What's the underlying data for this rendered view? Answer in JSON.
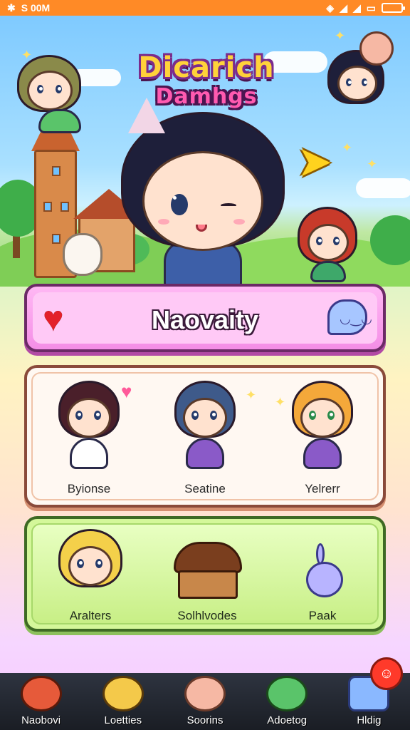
{
  "status_bar": {
    "left_text": "S 00M",
    "left_icon": "flash-icon",
    "right_icons": [
      "wifi-icon",
      "signal-icon",
      "signal-icon",
      "battery-icon"
    ]
  },
  "app": {
    "logo_line1": "Dicarich",
    "logo_line2": "Damhgs"
  },
  "banner": {
    "title": "Naovaity",
    "left_icon": "heart-icon",
    "right_icon": "speech-bubble-icon"
  },
  "characters": [
    {
      "label": "Byionse",
      "hair": "#4a1f2a",
      "shirt": "#ffffff"
    },
    {
      "label": "Seatine",
      "hair": "#3e5a8a",
      "shirt": "#8a5ac8"
    },
    {
      "label": "Yelrerr",
      "hair": "#f4a83a",
      "shirt": "#8a5ac8"
    }
  ],
  "collections": [
    {
      "label": "Aralters",
      "icon": "girl-avatar-icon"
    },
    {
      "label": "Solhlvodes",
      "icon": "treasure-chest-icon"
    },
    {
      "label": "Paak",
      "icon": "bunny-spirit-icon"
    }
  ],
  "bottom_nav": [
    {
      "label": "Naobovi",
      "icon": "redhead-avatar-icon",
      "color": "#e65a3a"
    },
    {
      "label": "Loetties",
      "icon": "blonde-avatar-icon",
      "color": "#f4c94a"
    },
    {
      "label": "Soorins",
      "icon": "bear-face-icon",
      "color": "#f6b8a4"
    },
    {
      "label": "Adoetog",
      "icon": "frog-icon",
      "color": "#5ac46a"
    },
    {
      "label": "Hldig",
      "icon": "gem-icon",
      "color": "#8ab8ff"
    }
  ],
  "colors": {
    "status_bar": "#ff8a26",
    "banner": "#f48ee6",
    "character_panel": "#fff8f2",
    "collection_panel": "#d4f79a",
    "nav_bar": "#1a1d24",
    "badge": "#ff3a2a"
  }
}
